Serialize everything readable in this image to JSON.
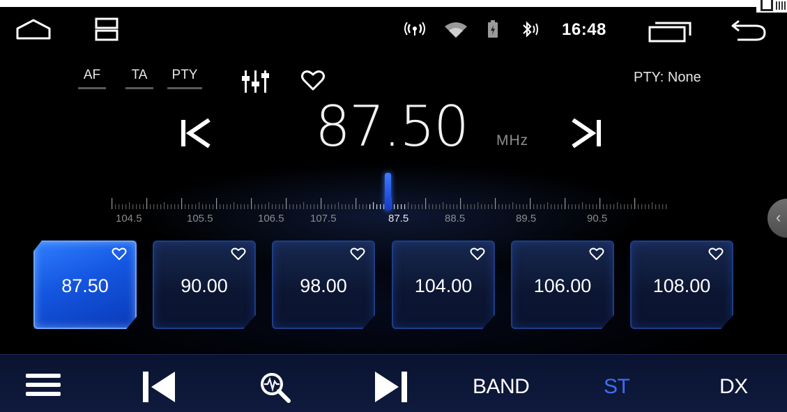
{
  "status_bar": {
    "time": "16:48",
    "icons": [
      "home-icon",
      "split-screen-icon",
      "radio-signal-icon",
      "wifi-icon",
      "battery-icon",
      "bluetooth-icon",
      "recent-apps-icon",
      "back-icon"
    ]
  },
  "toggles": {
    "af": "AF",
    "ta": "TA",
    "pty": "PTY"
  },
  "pty_status": "PTY: None",
  "frequency": {
    "value": "87.50",
    "unit": "MHz"
  },
  "dial": {
    "labels": [
      "104.5",
      "105.5",
      "106.5",
      "107.5",
      "87.5",
      "88.5",
      "89.5",
      "90.5"
    ],
    "current": "87.5"
  },
  "presets": [
    {
      "freq": "87.50",
      "active": true
    },
    {
      "freq": "90.00",
      "active": false
    },
    {
      "freq": "98.00",
      "active": false
    },
    {
      "freq": "104.00",
      "active": false
    },
    {
      "freq": "106.00",
      "active": false
    },
    {
      "freq": "108.00",
      "active": false
    }
  ],
  "bottom_bar": {
    "band": "BAND",
    "st": "ST",
    "dx": "DX"
  },
  "colors": {
    "accent": "#3d6df2",
    "active_preset": "#1f5ff0",
    "background": "#000000",
    "bottom_bar": "#0c1636"
  }
}
